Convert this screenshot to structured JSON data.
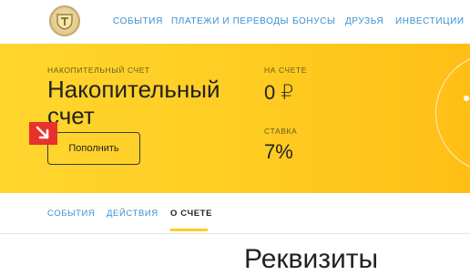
{
  "nav": {
    "items": [
      {
        "label": "События"
      },
      {
        "label": "Платежи и переводы"
      },
      {
        "label": "Бонусы"
      },
      {
        "label": "Друзья"
      },
      {
        "label": "Инвестиции"
      }
    ]
  },
  "account": {
    "type_label": "Накопительный счет",
    "title": "Накопительный счет",
    "balance_label": "На счете",
    "balance_value": "0 ₽",
    "rate_label": "Ставка",
    "rate_value": "7%",
    "topup_button": "Пополнить"
  },
  "tabs": [
    {
      "label": "События"
    },
    {
      "label": "Действия"
    },
    {
      "label": "О счете"
    }
  ],
  "active_tab": "О счете",
  "section": {
    "heading": "Реквизиты"
  },
  "colors": {
    "accent_yellow": "#ffcc22",
    "link_blue": "#3a8fd0",
    "arrow_badge_red": "#e8312c"
  },
  "icons": {
    "logo": "bank-crest-logo",
    "badge": "arrow-down-right-icon"
  }
}
